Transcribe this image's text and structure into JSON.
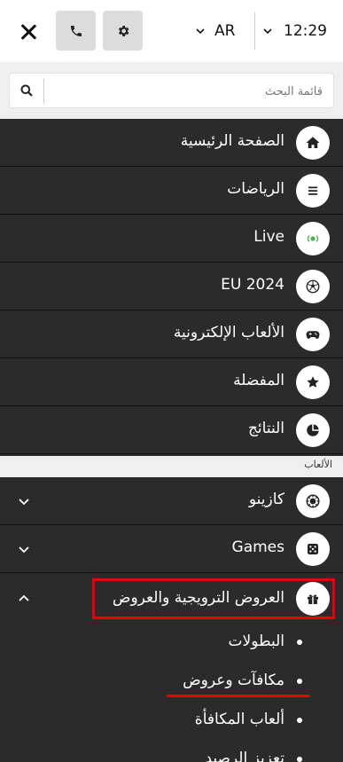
{
  "header": {
    "language": "AR",
    "time": "12:29"
  },
  "search": {
    "placeholder": "قائمة البحث"
  },
  "main_menu": [
    {
      "label": "الصفحة الرئيسية",
      "icon": "home-icon"
    },
    {
      "label": "الرياضات",
      "icon": "list-icon"
    },
    {
      "label": "Live",
      "icon": "live-icon"
    },
    {
      "label": "EU 2024",
      "icon": "soccer-ball-icon"
    },
    {
      "label": "الألعاب الإلكترونية",
      "icon": "gamepad-icon"
    },
    {
      "label": "المفضلة",
      "icon": "star-icon"
    },
    {
      "label": "النتائج",
      "icon": "pie-chart-icon"
    }
  ],
  "games_section": {
    "title": "الألعاب",
    "items": [
      {
        "label": "كازينو",
        "icon": "casino-chip-icon",
        "expanded": false
      },
      {
        "label": "Games",
        "icon": "dice-icon",
        "expanded": false
      },
      {
        "label": "العروض الترويجية والعروض",
        "icon": "gift-icon",
        "expanded": true
      }
    ],
    "promotions_sub": [
      "البطولات",
      "مكافآت وعروض",
      "ألعاب المكافأة",
      "تعزيز الرصيد"
    ]
  },
  "colors": {
    "menu_bg": "#2b2b2b",
    "highlight": "#e8000b",
    "live_green": "#4caf50"
  }
}
